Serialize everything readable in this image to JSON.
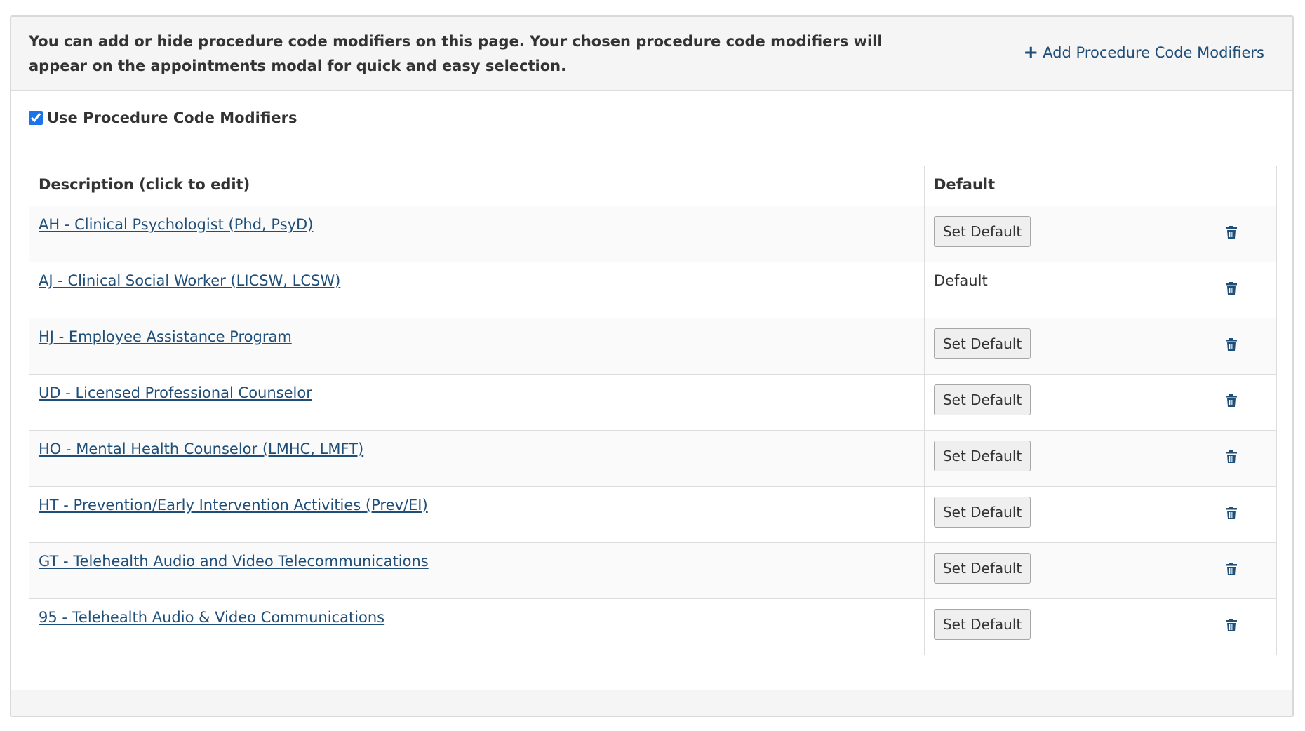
{
  "intro": {
    "text": "You can add or hide procedure code modifiers on this page. Your chosen procedure code modifiers will appear on the appointments modal for quick and easy selection."
  },
  "add_link": {
    "icon": "plus-icon",
    "label": "Add Procedure Code Modifiers"
  },
  "use_modifiers": {
    "label": "Use Procedure Code Modifiers",
    "checked": true
  },
  "table": {
    "headers": {
      "description": "Description (click to edit)",
      "default": "Default",
      "actions": ""
    },
    "set_default_label": "Set Default",
    "default_label": "Default",
    "rows": [
      {
        "description": "AH - Clinical Psychologist (Phd, PsyD)",
        "is_default": false
      },
      {
        "description": "AJ - Clinical Social Worker (LICSW, LCSW)",
        "is_default": true
      },
      {
        "description": "HJ - Employee Assistance Program",
        "is_default": false
      },
      {
        "description": "UD - Licensed Professional Counselor",
        "is_default": false
      },
      {
        "description": "HO - Mental Health Counselor (LMHC, LMFT)",
        "is_default": false
      },
      {
        "description": "HT - Prevention/Early Intervention Activities (Prev/EI)",
        "is_default": false
      },
      {
        "description": "GT - Telehealth Audio and Video Telecommunications",
        "is_default": false
      },
      {
        "description": "95 - Telehealth Audio & Video Communications",
        "is_default": false
      }
    ]
  },
  "colors": {
    "link": "#1f4e79",
    "header_bg": "#f5f5f5",
    "border": "#dddddd"
  }
}
